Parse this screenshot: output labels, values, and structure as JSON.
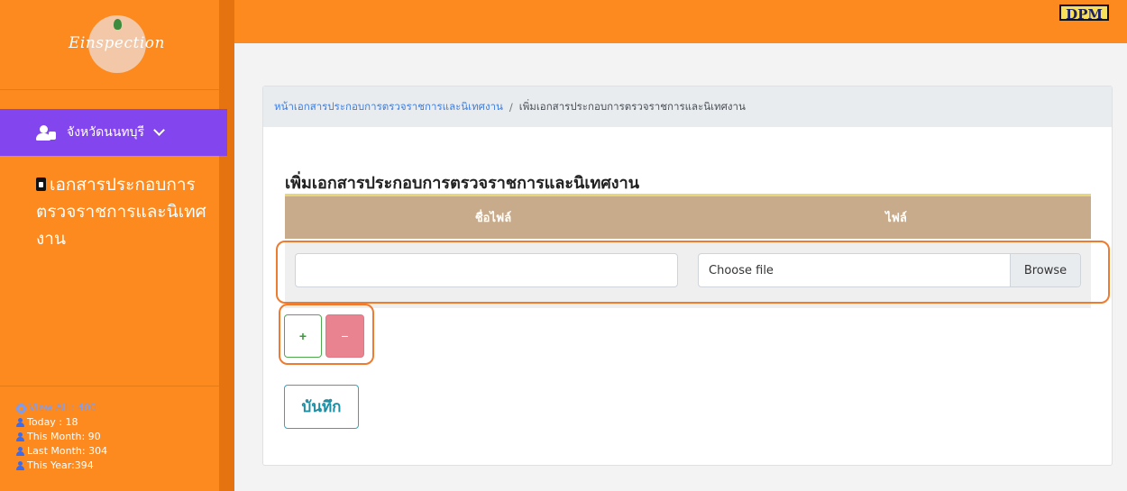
{
  "sidebar": {
    "logo_text": "Einspection",
    "user_label": "จังหวัดนนทบุรี",
    "nav_item_label": "เอกสารประกอบการตรวจราชการและนิเทศงาน",
    "stats": {
      "view_all": "View All : 400",
      "today": "Today : 18",
      "this_month": "This Month: 90",
      "last_month": "Last Month: 304",
      "this_year": "This Year:394"
    }
  },
  "topbar": {
    "badge": "DPM"
  },
  "breadcrumb": {
    "parent": "หน้าเอกสารประกอบการตรวจราชการและนิเทศงาน",
    "separator": "/",
    "current": "เพิ่มเอกสารประกอบการตรวจราชการและนิเทศงาน"
  },
  "main": {
    "title": "เพิ่มเอกสารประกอบการตรวจราชการและนิเทศงาน",
    "table": {
      "columns": [
        "ชื่อไฟล์",
        "ไฟล์"
      ],
      "rows": [
        {
          "name_value": "",
          "file_label": "Choose file",
          "browse_label": "Browse"
        }
      ]
    },
    "add_label": "+",
    "remove_label": "−",
    "save_label": "บันทึก"
  },
  "colors": {
    "sidebar": "#fd8a1f",
    "user_bar": "#8346ee",
    "table_head": "#c8ab8a",
    "highlight": "#ee7b2e"
  }
}
